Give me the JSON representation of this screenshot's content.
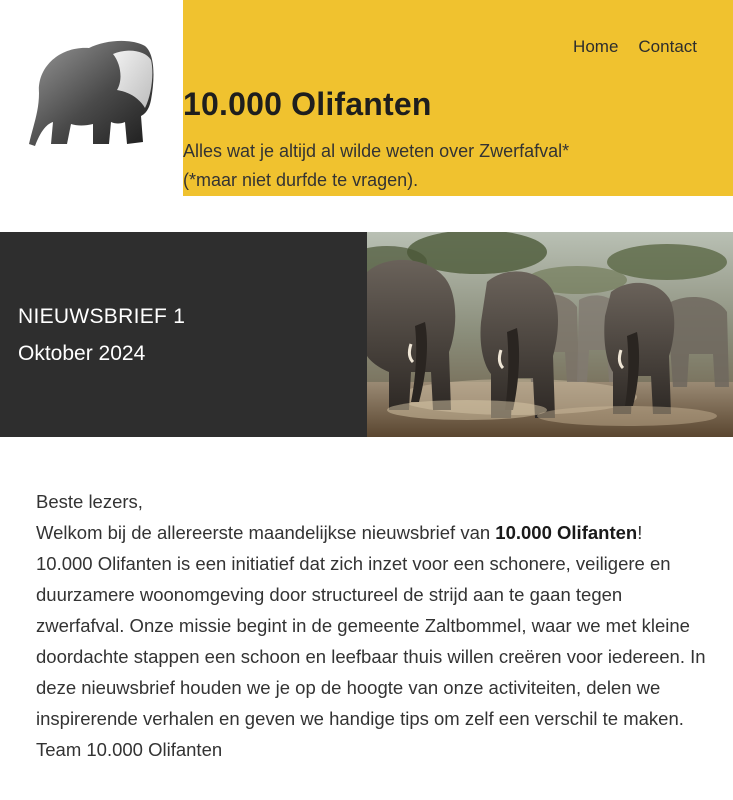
{
  "header": {
    "logo_icon": "elephant-logo-icon",
    "nav": [
      {
        "label": "Home"
      },
      {
        "label": "Contact"
      }
    ],
    "title": "10.000 Olifanten",
    "tagline_line1": "Alles wat je altijd al wilde weten over Zwerfafval*",
    "tagline_line2": "(*maar niet durfde te vragen).",
    "accent_color": "#f0c22f"
  },
  "banner": {
    "title": "NIEUWSBRIEF 1",
    "date": "Oktober 2024",
    "photo_icon": "elephant-herd-photo",
    "dark_color": "#2e2e2e"
  },
  "content": {
    "greeting": "Beste lezers,",
    "welcome_prefix": "Welkom bij de allereerste maandelijkse nieuwsbrief van ",
    "welcome_bold": "10.000 Olifanten",
    "welcome_suffix": "!",
    "body": "10.000 Olifanten is een initiatief dat zich inzet voor een schonere, veiligere en duurzamere woonomgeving door structureel de strijd aan te gaan tegen zwerfafval. Onze missie begint in de gemeente Zaltbommel, waar we met kleine doordachte stappen een schoon en leefbaar thuis willen creëren voor iedereen. In deze nieuwsbrief houden we je op de hoogte van onze activiteiten, delen we inspirerende verhalen en geven we handige tips om zelf een verschil te maken.",
    "signature": "Team 10.000 Olifanten"
  }
}
